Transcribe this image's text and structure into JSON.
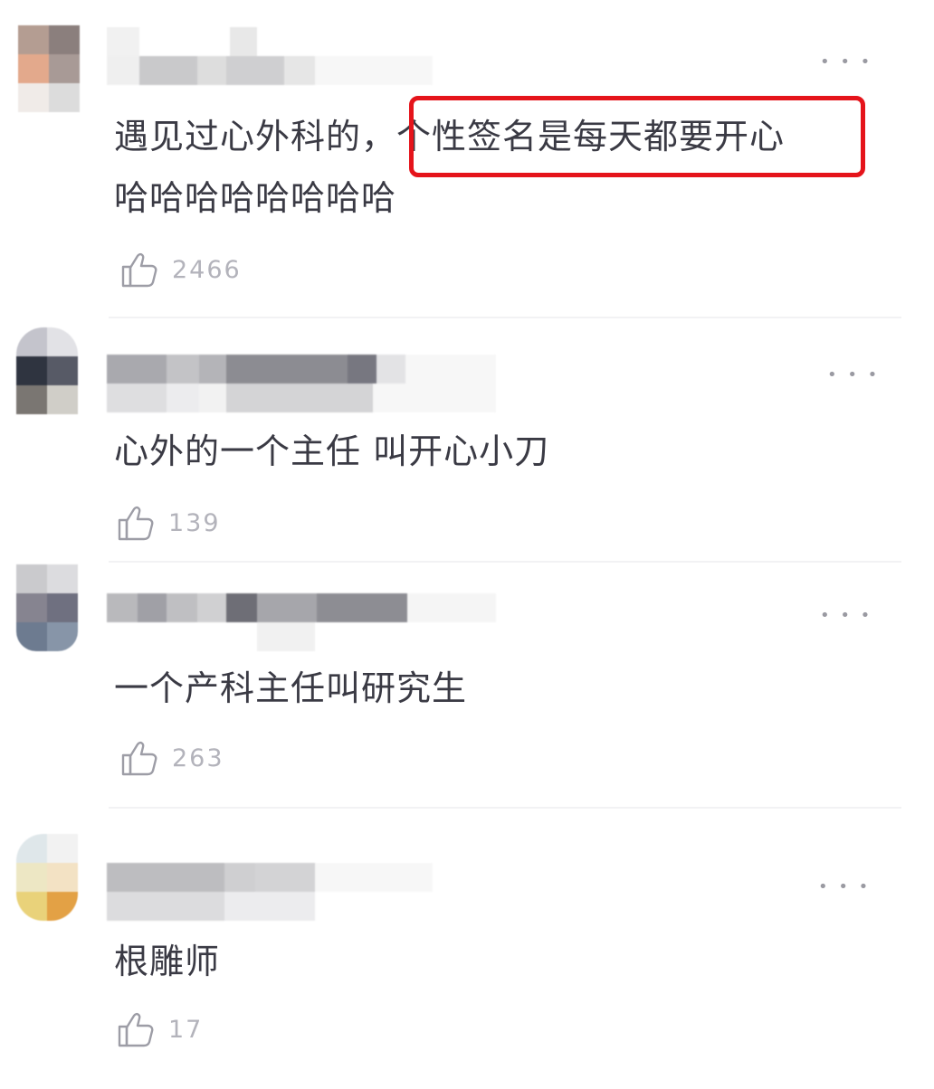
{
  "comments": [
    {
      "text_line1": "遇见过心外科的，个性签名是每天都要开心",
      "text_line2": "哈哈哈哈哈哈哈哈",
      "likes": "2466"
    },
    {
      "text_line1": "心外的一个主任 叫开心小刀",
      "likes": "139"
    },
    {
      "text_line1": "一个产科主任叫研究生",
      "likes": "263"
    },
    {
      "text_line1": "根雕师",
      "likes": "17"
    }
  ],
  "more_glyph": "• • •",
  "colors": {
    "highlight": "#e5141b",
    "text": "#3a3a44",
    "meta": "#b3b3bb"
  }
}
